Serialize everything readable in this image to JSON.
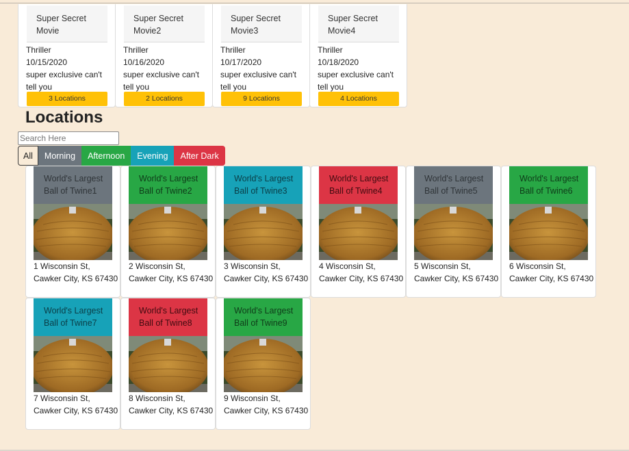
{
  "movies": [
    {
      "title": "Super Secret Movie",
      "genre": "Thriller",
      "date": "10/15/2020",
      "description": "super exclusive can't tell you",
      "locations_label": "3 Locations"
    },
    {
      "title": "Super Secret Movie2",
      "genre": "Thriller",
      "date": "10/16/2020",
      "description": "super exclusive can't tell you",
      "locations_label": "2 Locations"
    },
    {
      "title": "Super Secret Movie3",
      "genre": "Thriller",
      "date": "10/17/2020",
      "description": "super exclusive can't tell you",
      "locations_label": "9 Locations"
    },
    {
      "title": "Super Secret Movie4",
      "genre": "Thriller",
      "date": "10/18/2020",
      "description": "super exclusive can't tell you",
      "locations_label": "4 Locations"
    }
  ],
  "locations_section": {
    "heading": "Locations",
    "search_placeholder": "Search Here",
    "filters": [
      "All",
      "Morning",
      "Afternoon",
      "Evening",
      "After Dark"
    ],
    "selected_filter": "All"
  },
  "colors": {
    "page_bg": "#f9ebd8",
    "morning": "#6c757d",
    "afternoon": "#28a745",
    "evening": "#17a2b8",
    "after_dark": "#dc3545",
    "locations_button": "#ffc107"
  },
  "locations": [
    {
      "name": "World's Largest Ball of Twine1",
      "time": "morning",
      "address": "1 Wisconsin St, Cawker City, KS 67430",
      "image": "ball-of-twine-photo"
    },
    {
      "name": "World's Largest Ball of Twine2",
      "time": "afternoon",
      "address": "2 Wisconsin St, Cawker City, KS 67430",
      "image": "ball-of-twine-photo"
    },
    {
      "name": "World's Largest Ball of Twine3",
      "time": "evening",
      "address": "3 Wisconsin St, Cawker City, KS 67430",
      "image": "ball-of-twine-photo"
    },
    {
      "name": "World's Largest Ball of Twine4",
      "time": "after_dark",
      "address": "4 Wisconsin St, Cawker City, KS 67430",
      "image": "ball-of-twine-photo"
    },
    {
      "name": "World's Largest Ball of Twine5",
      "time": "morning",
      "address": "5 Wisconsin St, Cawker City, KS 67430",
      "image": "ball-of-twine-photo"
    },
    {
      "name": "World's Largest Ball of Twine6",
      "time": "afternoon",
      "address": "6 Wisconsin St, Cawker City, KS 67430",
      "image": "ball-of-twine-photo"
    },
    {
      "name": "World's Largest Ball of Twine7",
      "time": "evening",
      "address": "7 Wisconsin St, Cawker City, KS 67430",
      "image": "ball-of-twine-photo"
    },
    {
      "name": "World's Largest Ball of Twine8",
      "time": "after_dark",
      "address": "8 Wisconsin St, Cawker City, KS 67430",
      "image": "ball-of-twine-photo"
    },
    {
      "name": "World's Largest Ball of Twine9",
      "time": "afternoon",
      "address": "9 Wisconsin St, Cawker City, KS 67430",
      "image": "ball-of-twine-photo"
    }
  ]
}
